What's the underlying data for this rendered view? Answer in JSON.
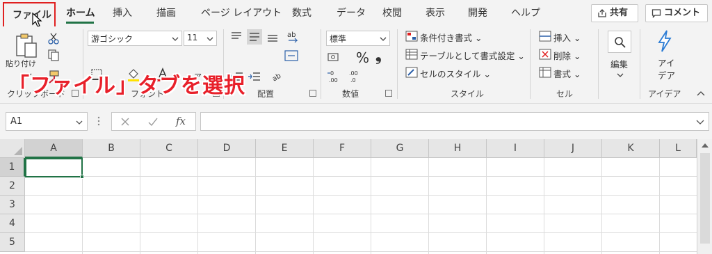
{
  "tabs": {
    "file": "ファイル",
    "home": "ホーム",
    "insert": "挿入",
    "draw": "描画",
    "page_layout": "ページ レイアウト",
    "formulas": "数式",
    "data": "データ",
    "review": "校閲",
    "view": "表示",
    "developer": "開発",
    "help": "ヘルプ",
    "share": "共有",
    "comment": "コメント"
  },
  "ribbon": {
    "clipboard": {
      "paste": "貼り付け",
      "label": "クリップボード"
    },
    "font": {
      "family": "游ゴシック",
      "size": "11",
      "label": "フォント"
    },
    "alignment": {
      "label": "配置"
    },
    "number": {
      "format": "標準",
      "percent": "%",
      "comma": "❟",
      "label": "数値"
    },
    "styles": {
      "conditional": "条件付き書式",
      "table": "テーブルとして書式設定",
      "cell_styles": "セルのスタイル",
      "label": "スタイル"
    },
    "cells": {
      "insert": "挿入",
      "delete": "削除",
      "format": "書式",
      "label": "セル"
    },
    "editing": {
      "label": "編集"
    },
    "ideas": {
      "line1": "アイ",
      "line2": "デア",
      "label": "アイデア"
    }
  },
  "overlay": "「ファイル」タブを選択",
  "formula_bar": {
    "name_box": "A1",
    "fx": "fx",
    "value": ""
  },
  "grid": {
    "columns": [
      "A",
      "B",
      "C",
      "D",
      "E",
      "F",
      "G",
      "H",
      "I",
      "J",
      "K",
      "L"
    ],
    "rows": [
      "1",
      "2",
      "3",
      "4",
      "5"
    ]
  },
  "colors": {
    "accent": "#217346",
    "highlight": "#e02020"
  }
}
